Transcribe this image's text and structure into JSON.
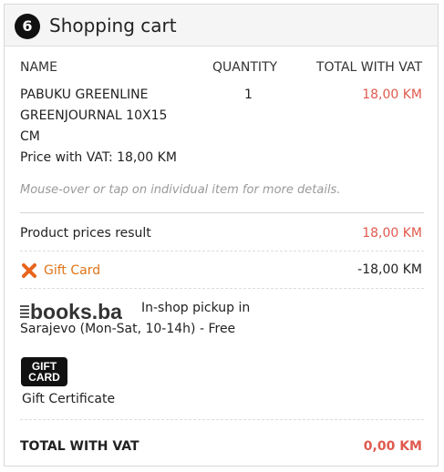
{
  "cart": {
    "step": "6",
    "title": "Shopping cart",
    "columns": {
      "name": "NAME",
      "quantity": "QUANTITY",
      "total": "TOTAL WITH VAT"
    },
    "item": {
      "name_line1": "PABUKU GREENLINE",
      "name_line2": "GREENJOURNAL 10X15",
      "name_line3": "CM",
      "price_with_vat": "Price with VAT: 18,00 KM",
      "quantity": "1",
      "total": "18,00 KM"
    },
    "hint": "Mouse-over or tap on individual item for more details.",
    "product_prices": {
      "label": "Product prices result",
      "value": "18,00 KM"
    },
    "gift_card": {
      "label": "Gift Card",
      "value": "-18,00 KM",
      "icon": "close-x-icon"
    },
    "delivery": {
      "logo_text": "books.ba",
      "line1": "In-shop pickup in",
      "line2": "Sarajevo (Mon-Sat, 10-14h) - Free"
    },
    "payment": {
      "card_line1": "GIFT",
      "card_line2": "CARD",
      "label": "Gift Certificate"
    },
    "grand_total": {
      "label": "TOTAL WITH VAT",
      "value": "0,00 KM"
    }
  },
  "colors": {
    "accent_red": "#e05a4e",
    "accent_orange": "#e07418"
  }
}
